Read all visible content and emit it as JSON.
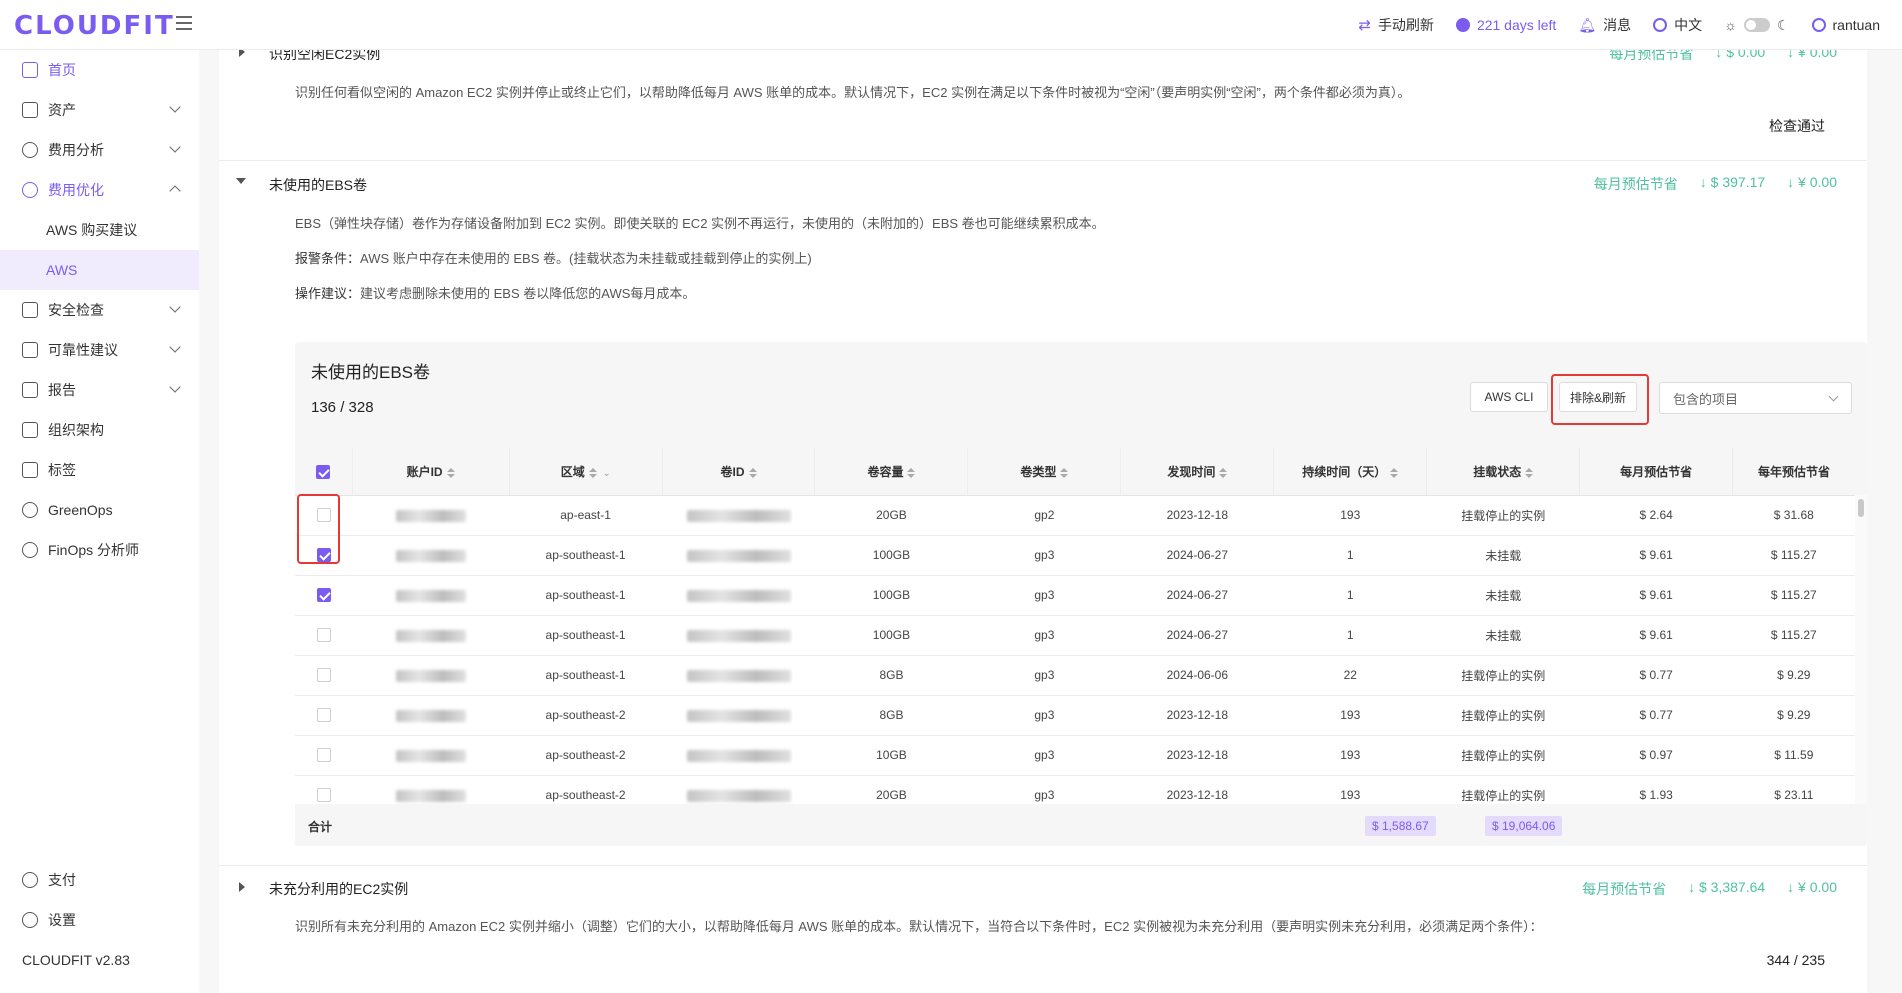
{
  "brand": {
    "logo": "CLOUDFIT"
  },
  "topbar": {
    "refresh": "手动刷新",
    "days_left": "221 days left",
    "messages": "消息",
    "language": "中文",
    "user": "rantuan"
  },
  "sidebar": {
    "items": [
      {
        "label": "首页",
        "icon": "home-icon",
        "active": true
      },
      {
        "label": "资产",
        "icon": "asset-icon",
        "chevron": "down"
      },
      {
        "label": "费用分析",
        "icon": "gauge-icon",
        "chevron": "down"
      },
      {
        "label": "费用优化",
        "icon": "dollar-icon",
        "chevron": "up",
        "active": true
      },
      {
        "label": "AWS 购买建议",
        "sub": true
      },
      {
        "label": "AWS",
        "sub": true,
        "selected": true
      },
      {
        "label": "安全检查",
        "icon": "alarm-icon",
        "chevron": "down"
      },
      {
        "label": "可靠性建议",
        "icon": "doc-check-icon",
        "chevron": "down"
      },
      {
        "label": "报告",
        "icon": "report-icon",
        "chevron": "down"
      },
      {
        "label": "组织架构",
        "icon": "org-icon"
      },
      {
        "label": "标签",
        "icon": "tag-icon"
      },
      {
        "label": "GreenOps",
        "icon": "leaf-icon"
      },
      {
        "label": "FinOps 分析师",
        "icon": "analyst-icon"
      }
    ],
    "footer": {
      "pay": "支付",
      "settings": "设置",
      "version": "CLOUDFIT v2.83"
    }
  },
  "section_idle_ec2": {
    "title": "识别空闲EC2实例",
    "description": "识别任何看似空闲的 Amazon EC2 实例并停止或终止它们，以帮助降低每月 AWS 账单的成本。默认情况下，EC2 实例在满足以下条件时被视为“空闲”（要声明实例“空闲”，两个条件都必须为真）。",
    "savings_label": "每月预估节省",
    "savings_usd": "↓ $ 0.00",
    "savings_cny": "↓ ¥ 0.00",
    "status": "检查通过"
  },
  "section_ebs": {
    "title": "未使用的EBS卷",
    "savings_label": "每月预估节省",
    "savings_usd": "↓ $ 397.17",
    "savings_cny": "↓ ¥ 0.00",
    "description": "EBS（弹性块存储）卷作为存储设备附加到 EC2 实例。即使关联的 EC2 实例不再运行，未使用的（未附加的）EBS 卷也可能继续累积成本。",
    "alert_label": "报警条件：",
    "alert": "AWS 账户中存在未使用的 EBS 卷。(挂载状态为未挂载或挂载到停止的实例上)",
    "action_label": "操作建议：",
    "action": "建议考虑删除未使用的 EBS 卷以降低您的AWS每月成本。",
    "card_title": "未使用的EBS卷",
    "count": "136 / 328",
    "btn_cli": "AWS CLI",
    "btn_refresh": "排除&刷新",
    "select_value": "包含的项目",
    "columns": [
      "账户ID",
      "区域",
      "卷ID",
      "卷容量",
      "卷类型",
      "发现时间",
      "持续时间（天）",
      "挂载状态",
      "每月预估节省",
      "每年预估节省"
    ],
    "rows": [
      {
        "checked": false,
        "region": "ap-east-1",
        "size": "20GB",
        "type": "gp2",
        "found": "2023-12-18",
        "days": "193",
        "state": "挂载停止的实例",
        "monthly": "$ 2.64",
        "yearly": "$ 31.68"
      },
      {
        "checked": true,
        "region": "ap-southeast-1",
        "size": "100GB",
        "type": "gp3",
        "found": "2024-06-27",
        "days": "1",
        "state": "未挂载",
        "monthly": "$ 9.61",
        "yearly": "$ 115.27"
      },
      {
        "checked": true,
        "region": "ap-southeast-1",
        "size": "100GB",
        "type": "gp3",
        "found": "2024-06-27",
        "days": "1",
        "state": "未挂载",
        "monthly": "$ 9.61",
        "yearly": "$ 115.27"
      },
      {
        "checked": false,
        "region": "ap-southeast-1",
        "size": "100GB",
        "type": "gp3",
        "found": "2024-06-27",
        "days": "1",
        "state": "未挂载",
        "monthly": "$ 9.61",
        "yearly": "$ 115.27"
      },
      {
        "checked": false,
        "region": "ap-southeast-1",
        "size": "8GB",
        "type": "gp3",
        "found": "2024-06-06",
        "days": "22",
        "state": "挂载停止的实例",
        "monthly": "$ 0.77",
        "yearly": "$ 9.29"
      },
      {
        "checked": false,
        "region": "ap-southeast-2",
        "size": "8GB",
        "type": "gp3",
        "found": "2023-12-18",
        "days": "193",
        "state": "挂载停止的实例",
        "monthly": "$ 0.77",
        "yearly": "$ 9.29"
      },
      {
        "checked": false,
        "region": "ap-southeast-2",
        "size": "10GB",
        "type": "gp3",
        "found": "2023-12-18",
        "days": "193",
        "state": "挂载停止的实例",
        "monthly": "$ 0.97",
        "yearly": "$ 11.59"
      },
      {
        "checked": false,
        "region": "ap-southeast-2",
        "size": "20GB",
        "type": "gp3",
        "found": "2023-12-18",
        "days": "193",
        "state": "挂载停止的实例",
        "monthly": "$ 1.93",
        "yearly": "$ 23.11"
      }
    ],
    "total_label": "合计",
    "total_monthly": "$ 1,588.67",
    "total_yearly": "$ 19,064.06"
  },
  "section_underused_ec2": {
    "title": "未充分利用的EC2实例",
    "savings_label": "每月预估节省",
    "savings_usd": "↓ $ 3,387.64",
    "savings_cny": "↓ ¥ 0.00",
    "description": "识别所有未充分利用的 Amazon EC2 实例并缩小（调整）它们的大小，以帮助降低每月 AWS 账单的成本。默认情况下，当符合以下条件时，EC2 实例被视为未充分利用（要声明实例未充分利用，必须满足两个条件）：",
    "count": "344 / 235"
  },
  "colors": {
    "accent": "#7b5cf0",
    "savings": "#4fc1a0",
    "highlight": "#e53935"
  }
}
